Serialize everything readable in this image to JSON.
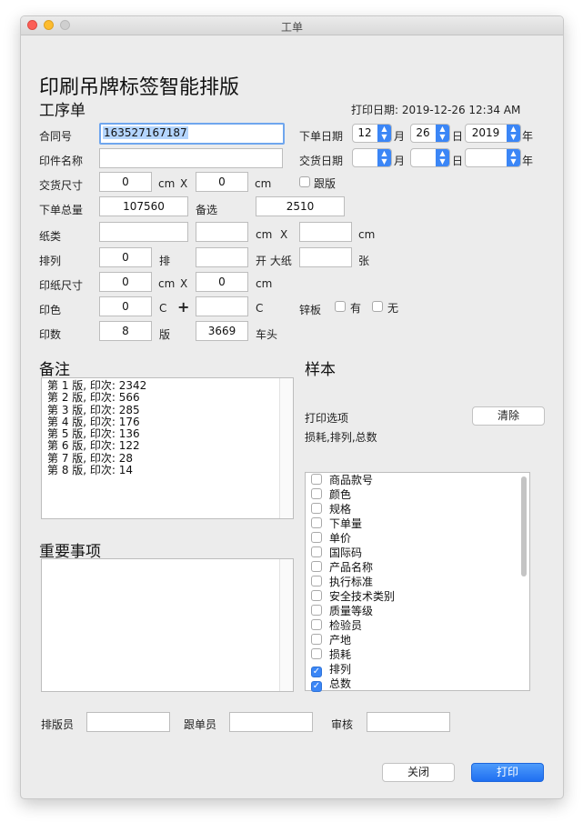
{
  "window": {
    "title": "工单"
  },
  "header": {
    "main_title": "印刷吊牌标签智能排版",
    "subtitle": "工序单",
    "print_date": "打印日期: 2019-12-26  12:34 AM"
  },
  "form": {
    "contract_no_label": "合同号",
    "contract_no_value": "163527167187",
    "item_name_label": "印件名称",
    "item_name_value": "",
    "delivery_size_label": "交货尺寸",
    "delivery_w": "0",
    "delivery_h": "0",
    "unit_cm": "cm",
    "x_sign": "X",
    "proof_label": "跟版",
    "order_total_label": "下单总量",
    "order_total_value": "107560",
    "spare_label": "备选",
    "spare_value": "2510",
    "paper_label": "纸类",
    "paper_value": "",
    "paper_w": "",
    "paper_h": "",
    "arrange_label": "排列",
    "arrange_value": "0",
    "arrange_unit": "排",
    "open_value": "",
    "open_label": "开 大纸",
    "big_paper_value": "",
    "sheet_unit": "张",
    "print_size_label": "印纸尺寸",
    "print_w": "0",
    "print_h": "0",
    "color_label": "印色",
    "color_value": "0",
    "c_label": "C",
    "plus": "+",
    "color_extra": "",
    "zinc_label": "锌板",
    "zinc_yes": "有",
    "zinc_no": "无",
    "print_count_label": "印数",
    "print_count_value": "8",
    "print_count_unit": "版",
    "head_value": "3669",
    "head_label": "车头",
    "order_date_label": "下单日期",
    "order_month": "12",
    "order_day": "26",
    "order_year": "2019",
    "delivery_date_label": "交货日期",
    "delivery_month": "",
    "delivery_day": "",
    "delivery_year": "",
    "month_label": "月",
    "day_label": "日",
    "year_label": "年"
  },
  "notes": {
    "title": "备注",
    "lines": [
      "第 1 版, 印次: 2342",
      "第 2 版, 印次: 566",
      "第 3 版, 印次: 285",
      "第 4 版, 印次: 176",
      "第 5 版, 印次: 136",
      "第 6 版, 印次: 122",
      "第 7 版, 印次: 28",
      "第 8 版, 印次: 14"
    ]
  },
  "important": {
    "title": "重要事项"
  },
  "sample": {
    "title": "样本",
    "print_options_label": "打印选项",
    "clear_button": "清除",
    "selected_summary": "损耗,排列,总数",
    "items": [
      {
        "label": "商品款号",
        "checked": false
      },
      {
        "label": "颜色",
        "checked": false
      },
      {
        "label": "规格",
        "checked": false
      },
      {
        "label": "下单量",
        "checked": false
      },
      {
        "label": "单价",
        "checked": false
      },
      {
        "label": "国际码",
        "checked": false
      },
      {
        "label": "产品名称",
        "checked": false
      },
      {
        "label": "执行标准",
        "checked": false
      },
      {
        "label": "安全技术类别",
        "checked": false
      },
      {
        "label": "质量等级",
        "checked": false
      },
      {
        "label": "检验员",
        "checked": false
      },
      {
        "label": "产地",
        "checked": false
      },
      {
        "label": "损耗",
        "checked": false
      },
      {
        "label": "排列",
        "checked": true
      },
      {
        "label": "总数",
        "checked": true
      }
    ]
  },
  "footer": {
    "typesetter_label": "排版员",
    "follower_label": "跟单员",
    "reviewer_label": "审核",
    "close_button": "关闭",
    "print_button": "打印"
  },
  "colors": {
    "accent": "#3b86f6",
    "selection": "#b4d5fe"
  }
}
